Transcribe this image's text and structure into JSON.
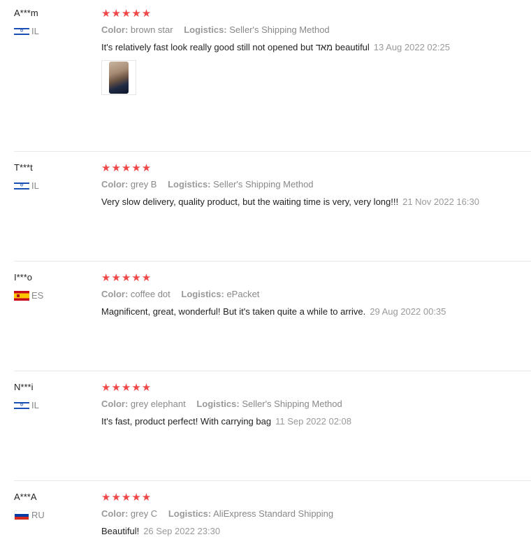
{
  "labels": {
    "color": "Color:",
    "logistics": "Logistics:"
  },
  "rating_stars": "★★★★★",
  "reviews": [
    {
      "user": "A***m",
      "country": "IL",
      "color": "brown star",
      "logistics": "Seller's Shipping Method",
      "text": "It's relatively fast look really good still not opened but מאד beautiful",
      "date": "13 Aug 2022 02:25"
    },
    {
      "user": "T***t",
      "country": "IL",
      "color": "grey B",
      "logistics": "Seller's Shipping Method",
      "text": "Very slow delivery, quality product, but the waiting time is very, very long!!!",
      "date": "21 Nov 2022 16:30"
    },
    {
      "user": "I***o",
      "country": "ES",
      "color": "coffee dot",
      "logistics": "ePacket",
      "text": "Magnificent, great, wonderful! But it's taken quite a while to arrive.",
      "date": "29 Aug 2022 00:35"
    },
    {
      "user": "N***i",
      "country": "IL",
      "color": "grey elephant",
      "logistics": "Seller's Shipping Method",
      "text": "It's fast, product perfect! With carrying bag",
      "date": "11 Sep 2022 02:08"
    },
    {
      "user": "A***A",
      "country": "RU",
      "color": "grey C",
      "logistics": "AliExpress Standard Shipping",
      "text": "Beautiful!",
      "date": "26 Sep 2022 23:30"
    }
  ]
}
